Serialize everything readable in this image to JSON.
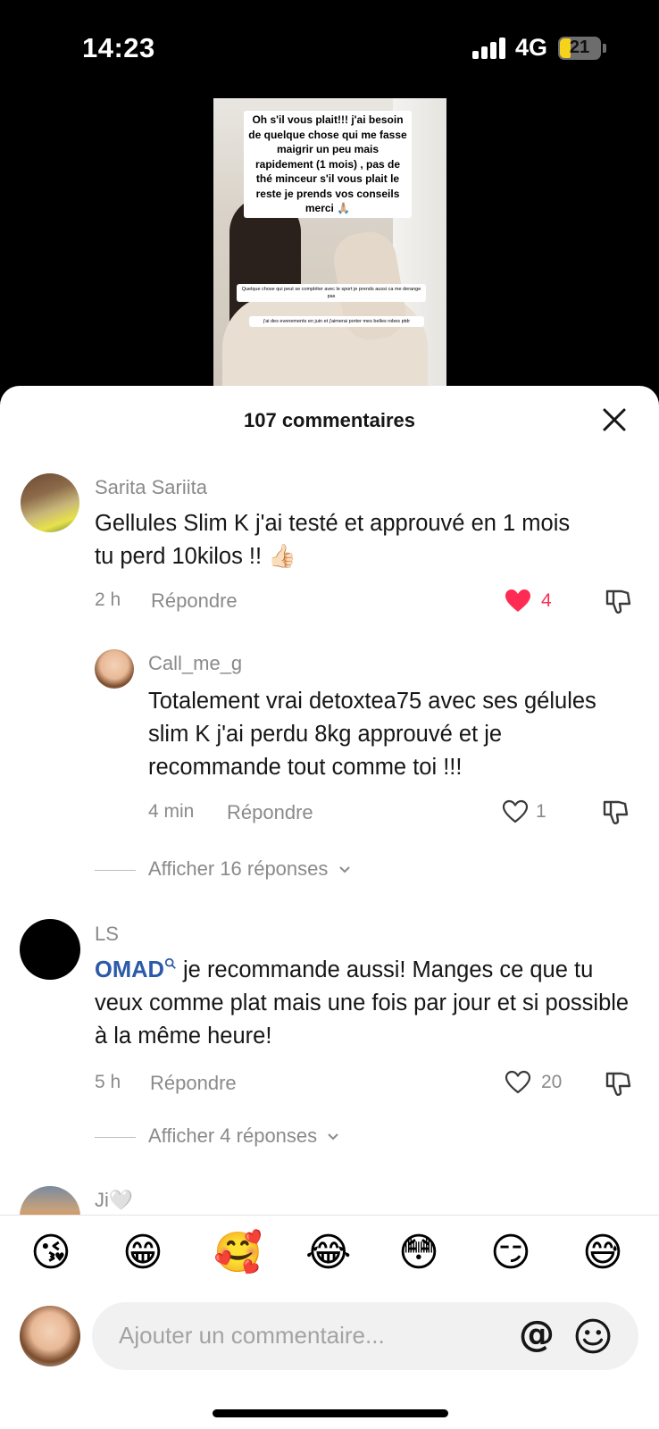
{
  "status_bar": {
    "time": "14:23",
    "network": "4G",
    "battery": "21"
  },
  "video": {
    "caption": "Oh s'il vous plait!!! j'ai besoin de quelque chose qui me fasse maigrir un peu mais rapidement (1 mois) , pas de thé minceur s'il vous plait le reste je prends vos conseils merci 🙏🏼",
    "note1": "Quelque chose qui peut se compléter avec le sport je prends aussi ca me derange pas",
    "note2": "j'ai des evenements en juin et j'aimerai porter mes belles robes ptdr"
  },
  "sheet": {
    "title": "107 commentaires"
  },
  "comments": [
    {
      "username": "Sarita Sariita",
      "text": "Gellules Slim K j'ai testé et approuvé en 1 mois tu perd 10kilos !! 👍🏻",
      "time": "2 h",
      "reply": "Répondre",
      "likes": "4"
    },
    {
      "username": "Call_me_g",
      "text": "Totalement vrai detoxtea75 avec ses gélules slim K j'ai perdu 8kg approuvé et je recommande tout comme toi !!!",
      "time": "4 min",
      "reply": "Répondre",
      "likes": "1"
    },
    {
      "username": "LS",
      "mention": "OMAD",
      "text": " je recommande aussi! Manges ce que tu veux comme plat mais une fois par jour et si possible à la même heure!",
      "time": "5 h",
      "reply": "Répondre",
      "likes": "20"
    },
    {
      "username": "Ji🤍"
    }
  ],
  "view_replies": [
    "Afficher 16 réponses",
    "Afficher 4 réponses"
  ],
  "emoji_bar": [
    "😘",
    "😁",
    "🥰",
    "😂",
    "😳",
    "😏",
    "😅"
  ],
  "input": {
    "placeholder": "Ajouter un commentaire...",
    "mention_symbol": "@"
  },
  "colors": {
    "like_red": "#fe2c55",
    "mention_blue": "#2b5aa8",
    "battery_yellow": "#f6d21a"
  }
}
